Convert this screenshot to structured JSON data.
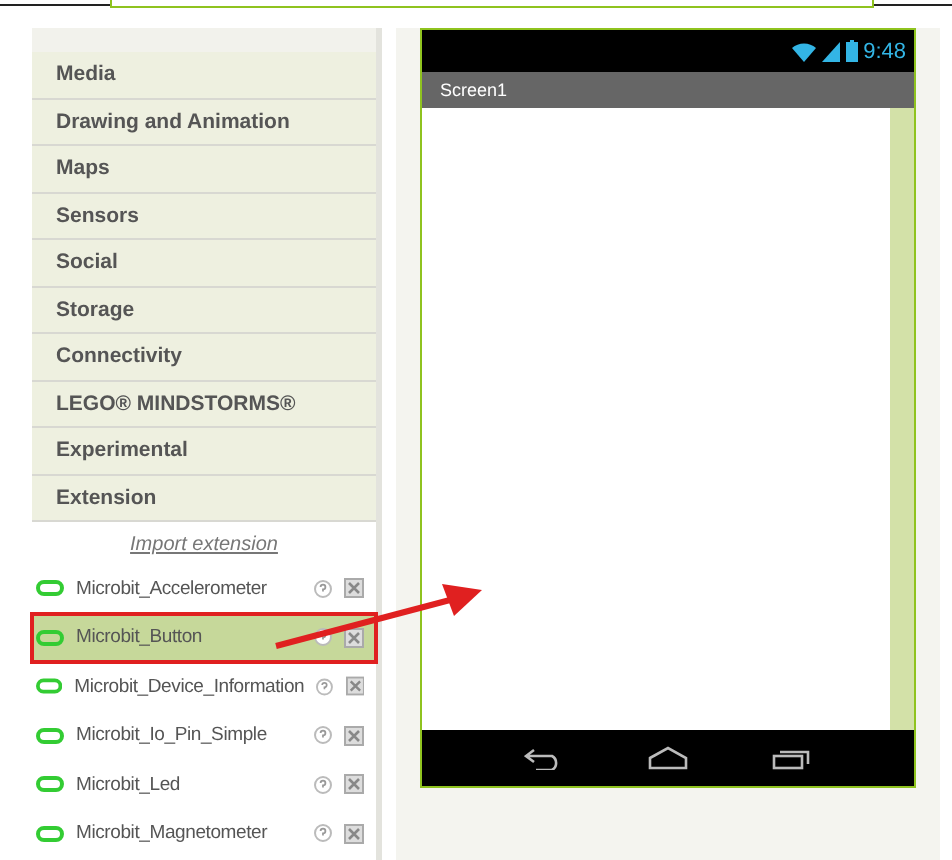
{
  "palette": {
    "categories": [
      {
        "label": "Media"
      },
      {
        "label": "Drawing and Animation"
      },
      {
        "label": "Maps"
      },
      {
        "label": "Sensors"
      },
      {
        "label": "Social"
      },
      {
        "label": "Storage"
      },
      {
        "label": "Connectivity"
      },
      {
        "label": "LEGO® MINDSTORMS®"
      },
      {
        "label": "Experimental"
      },
      {
        "label": "Extension"
      }
    ],
    "import_link": "Import extension",
    "extensions": [
      {
        "name": "Microbit_Accelerometer",
        "selected": false
      },
      {
        "name": "Microbit_Button",
        "selected": true
      },
      {
        "name": "Microbit_Device_Information",
        "selected": false
      },
      {
        "name": "Microbit_Io_Pin_Simple",
        "selected": false
      },
      {
        "name": "Microbit_Led",
        "selected": false
      },
      {
        "name": "Microbit_Magnetometer",
        "selected": false
      }
    ]
  },
  "viewer": {
    "status_time": "9:48",
    "screen_title": "Screen1"
  }
}
